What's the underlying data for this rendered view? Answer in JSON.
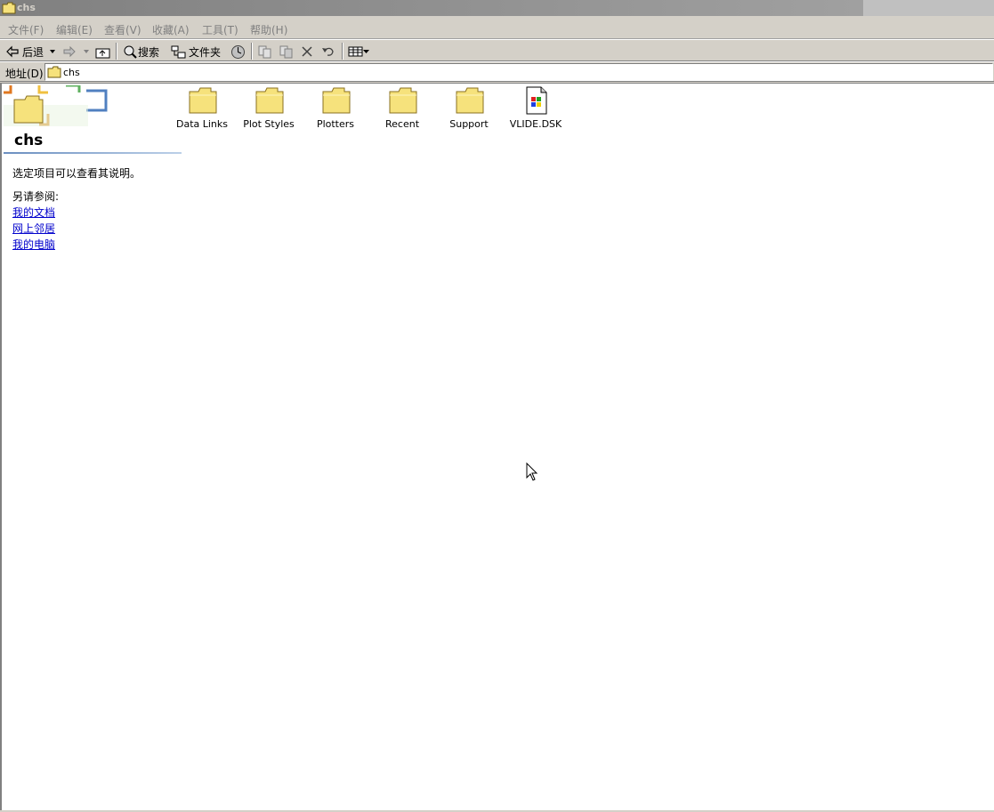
{
  "window": {
    "title": "chs"
  },
  "menu": [
    {
      "label": "文件(F)"
    },
    {
      "label": "编辑(E)"
    },
    {
      "label": "查看(V)"
    },
    {
      "label": "收藏(A)"
    },
    {
      "label": "工具(T)"
    },
    {
      "label": "帮助(H)"
    }
  ],
  "toolbar": {
    "back_label": "后退",
    "search_label": "搜索",
    "folders_label": "文件夹"
  },
  "address": {
    "label": "地址(D)",
    "value": "chs"
  },
  "sidebar": {
    "title": "chs",
    "description": "选定项目可以查看其说明。",
    "see_also": "另请参阅:",
    "links": [
      "我的文档",
      "网上邻居",
      "我的电脑"
    ]
  },
  "files": [
    {
      "name": "Data Links",
      "type": "folder-icon"
    },
    {
      "name": "Plot Styles",
      "type": "folder-icon"
    },
    {
      "name": "Plotters",
      "type": "folder-icon"
    },
    {
      "name": "Recent",
      "type": "folder-icon"
    },
    {
      "name": "Support",
      "type": "folder-icon"
    },
    {
      "name": "VLIDE.DSK",
      "type": "windows-file-icon"
    }
  ],
  "colors": {
    "link": "#0000cc",
    "titlebar": "#808080",
    "chrome": "#d4d0c8"
  }
}
